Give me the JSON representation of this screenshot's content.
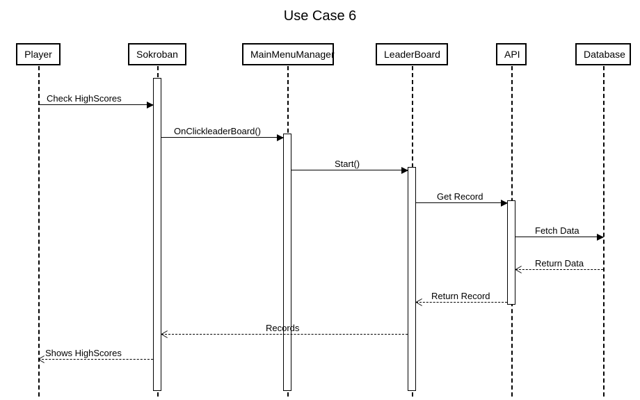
{
  "title": "Use Case 6",
  "participants": {
    "player": "Player",
    "sokroban": "Sokroban",
    "mmm": "MainMenuManager",
    "leaderboard": "LeaderBoard",
    "api": "API",
    "database": "Database"
  },
  "messages": {
    "m1": "Check HighScores",
    "m2": "OnClickleaderBoard()",
    "m3": "Start()",
    "m4": "Get Record",
    "m5": "Fetch Data",
    "r5": "Return Data",
    "r4": "Return Record",
    "r3": "Records",
    "r1": "Shows HighScores"
  }
}
